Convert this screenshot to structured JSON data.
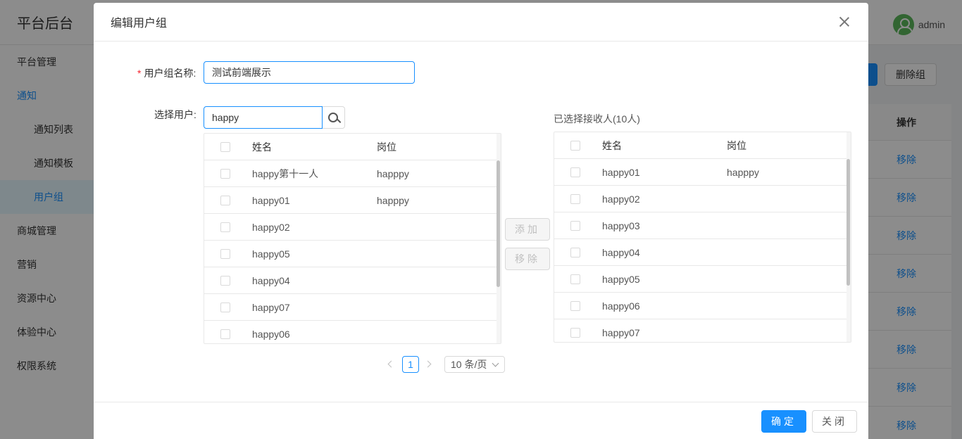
{
  "background": {
    "logo": "平台后台",
    "user": "admin",
    "sidebar": [
      {
        "label": "平台管理",
        "type": "top"
      },
      {
        "label": "通知",
        "type": "blue"
      },
      {
        "label": "通知列表",
        "type": "sub"
      },
      {
        "label": "通知模板",
        "type": "sub"
      },
      {
        "label": "用户组",
        "type": "active"
      },
      {
        "label": "商城管理",
        "type": "top"
      },
      {
        "label": "营销",
        "type": "top"
      },
      {
        "label": "资源中心",
        "type": "top"
      },
      {
        "label": "体验中心",
        "type": "top"
      },
      {
        "label": "权限系统",
        "type": "top"
      }
    ],
    "delete_group_btn": "删除组",
    "table_header_op": "操作",
    "remove_link": "移除",
    "remove_link_count": 8
  },
  "modal": {
    "title": "编辑用户组",
    "group_name_label": "用户组名称:",
    "group_name_value": "测试前端展示",
    "select_user_label": "选择用户:",
    "search_value": "happy",
    "left_table": {
      "headers": {
        "name": "姓名",
        "position": "岗位"
      },
      "rows": [
        {
          "name": "happy第十一人",
          "position": "happpy"
        },
        {
          "name": "happy01",
          "position": "happpy"
        },
        {
          "name": "happy02",
          "position": ""
        },
        {
          "name": "happy05",
          "position": ""
        },
        {
          "name": "happy04",
          "position": ""
        },
        {
          "name": "happy07",
          "position": ""
        },
        {
          "name": "happy06",
          "position": ""
        }
      ]
    },
    "add_btn": "添加",
    "remove_btn": "移除",
    "selected_title": "已选择接收人(10人)",
    "right_table": {
      "headers": {
        "name": "姓名",
        "position": "岗位"
      },
      "rows": [
        {
          "name": "happy01",
          "position": "happpy"
        },
        {
          "name": "happy02",
          "position": ""
        },
        {
          "name": "happy03",
          "position": ""
        },
        {
          "name": "happy04",
          "position": ""
        },
        {
          "name": "happy05",
          "position": ""
        },
        {
          "name": "happy06",
          "position": ""
        },
        {
          "name": "happy07",
          "position": ""
        }
      ]
    },
    "pagination": {
      "current": "1",
      "page_size": "10 条/页"
    },
    "ok_btn": "确定",
    "close_btn": "关闭"
  }
}
